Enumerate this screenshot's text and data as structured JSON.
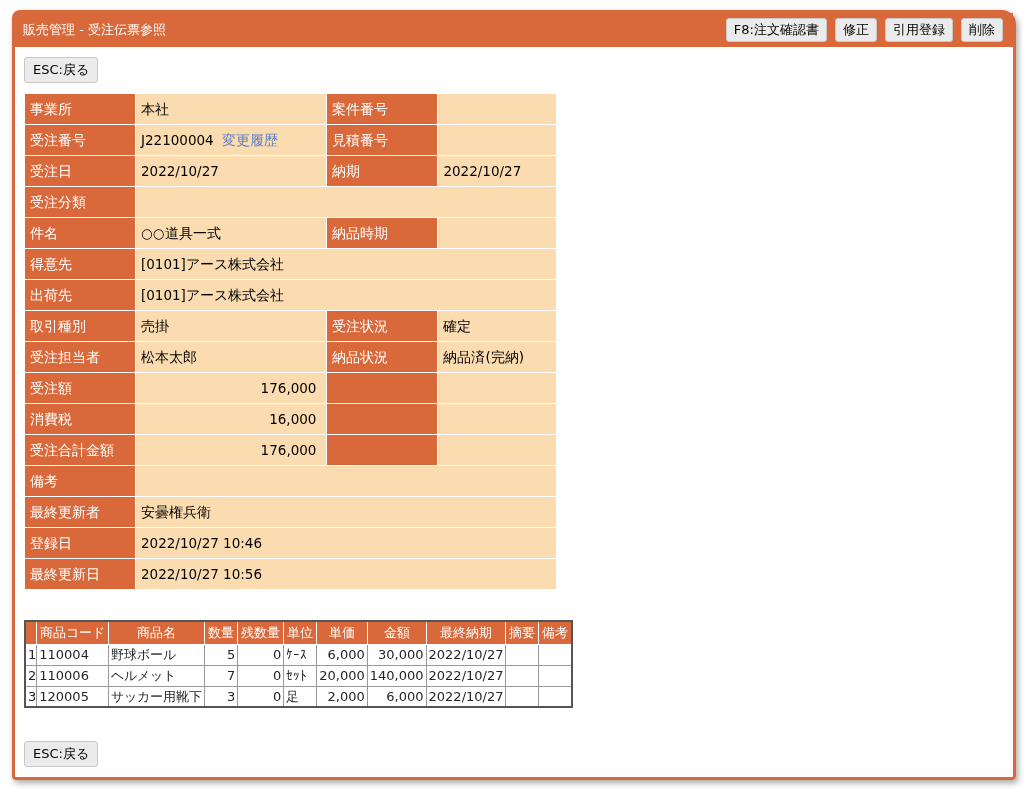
{
  "window": {
    "title": "販売管理 - 受注伝票参照"
  },
  "toolbar_buttons": [
    "F8:注文確認書",
    "修正",
    "引用登録",
    "削除"
  ],
  "top_back_button": "ESC:戻る",
  "info_rows": [
    {
      "kind": "pair",
      "cells": [
        {
          "kind": "label",
          "text": "事業所"
        },
        {
          "kind": "value",
          "text": "本社"
        },
        {
          "kind": "label",
          "text": "案件番号"
        },
        {
          "kind": "value"
        }
      ]
    },
    {
      "kind": "pair",
      "cells": [
        {
          "kind": "label",
          "text": "受注番号"
        },
        {
          "kind": "value",
          "text": "J22100004",
          "link": "変更履歴"
        },
        {
          "kind": "label",
          "text": "見積番号"
        },
        {
          "kind": "value"
        }
      ]
    },
    {
      "kind": "pair",
      "cells": [
        {
          "kind": "label",
          "text": "受注日"
        },
        {
          "kind": "value",
          "text": "2022/10/27"
        },
        {
          "kind": "label",
          "text": "納期"
        },
        {
          "kind": "value",
          "text": "2022/10/27"
        }
      ]
    },
    {
      "kind": "full",
      "cells": [
        {
          "kind": "label",
          "text": "受注分類"
        },
        {
          "kind": "value"
        }
      ]
    },
    {
      "kind": "pair",
      "cells": [
        {
          "kind": "label",
          "text": "件名"
        },
        {
          "kind": "value",
          "text": "○○道具一式"
        },
        {
          "kind": "label",
          "text": "納品時期"
        },
        {
          "kind": "value"
        }
      ]
    },
    {
      "kind": "full",
      "cells": [
        {
          "kind": "label",
          "text": "得意先"
        },
        {
          "kind": "value",
          "text": "[0101]アース株式会社"
        }
      ]
    },
    {
      "kind": "full",
      "cells": [
        {
          "kind": "label",
          "text": "出荷先"
        },
        {
          "kind": "value",
          "text": "[0101]アース株式会社"
        }
      ]
    },
    {
      "kind": "pair",
      "cells": [
        {
          "kind": "label",
          "text": "取引種別"
        },
        {
          "kind": "value",
          "text": "売掛"
        },
        {
          "kind": "label",
          "text": "受注状況"
        },
        {
          "kind": "value",
          "text": "確定"
        }
      ]
    },
    {
      "kind": "pair",
      "cells": [
        {
          "kind": "label",
          "text": "受注担当者"
        },
        {
          "kind": "value",
          "text": "松本太郎"
        },
        {
          "kind": "label",
          "text": "納品状況"
        },
        {
          "kind": "value",
          "text": "納品済(完納)"
        }
      ]
    },
    {
      "kind": "pair",
      "cells": [
        {
          "kind": "label",
          "text": "受注額"
        },
        {
          "kind": "amount",
          "text": "176,000"
        },
        {
          "kind": "label"
        },
        {
          "kind": "value"
        }
      ]
    },
    {
      "kind": "pair",
      "cells": [
        {
          "kind": "label",
          "text": "消費税"
        },
        {
          "kind": "amount",
          "text": "16,000"
        },
        {
          "kind": "label"
        },
        {
          "kind": "value"
        }
      ]
    },
    {
      "kind": "pair",
      "cells": [
        {
          "kind": "label",
          "text": "受注合計金額"
        },
        {
          "kind": "amount",
          "text": "176,000"
        },
        {
          "kind": "label"
        },
        {
          "kind": "value"
        }
      ]
    },
    {
      "kind": "full",
      "cells": [
        {
          "kind": "label",
          "text": "備考"
        },
        {
          "kind": "value"
        }
      ]
    },
    {
      "kind": "full",
      "cells": [
        {
          "kind": "label",
          "text": "最終更新者"
        },
        {
          "kind": "value",
          "text": "安曇権兵衛"
        }
      ]
    },
    {
      "kind": "full",
      "cells": [
        {
          "kind": "label",
          "text": "登録日"
        },
        {
          "kind": "value",
          "text": "2022/10/27 10:46"
        }
      ]
    },
    {
      "kind": "full",
      "cells": [
        {
          "kind": "label",
          "text": "最終更新日"
        },
        {
          "kind": "value",
          "text": "2022/10/27 10:56"
        }
      ]
    }
  ],
  "items_table": {
    "columns": [
      {
        "kind": "index"
      },
      {
        "text": "商品コード",
        "kind": "text"
      },
      {
        "text": "商品名",
        "kind": "text"
      },
      {
        "text": "数量",
        "kind": "number"
      },
      {
        "text": "残数量",
        "kind": "number"
      },
      {
        "text": "単位",
        "kind": "text"
      },
      {
        "text": "単価",
        "kind": "number"
      },
      {
        "text": "金額",
        "kind": "number"
      },
      {
        "text": "最終納期",
        "kind": "text"
      },
      {
        "text": "摘要",
        "kind": "text"
      },
      {
        "text": "備考",
        "kind": "text"
      }
    ],
    "rows": [
      [
        "1",
        "110004",
        "野球ボール",
        "5",
        "0",
        "ｹｰｽ",
        "6,000",
        "30,000",
        "2022/10/27",
        null,
        null
      ],
      [
        "2",
        "110006",
        "ヘルメット",
        "7",
        "0",
        "ｾｯﾄ",
        "20,000",
        "140,000",
        "2022/10/27",
        null,
        null
      ],
      [
        "3",
        "120005",
        "サッカー用靴下",
        "3",
        "0",
        "足",
        "2,000",
        "6,000",
        "2022/10/27",
        null,
        null
      ]
    ]
  },
  "bottom_back_button": "ESC:戻る"
}
